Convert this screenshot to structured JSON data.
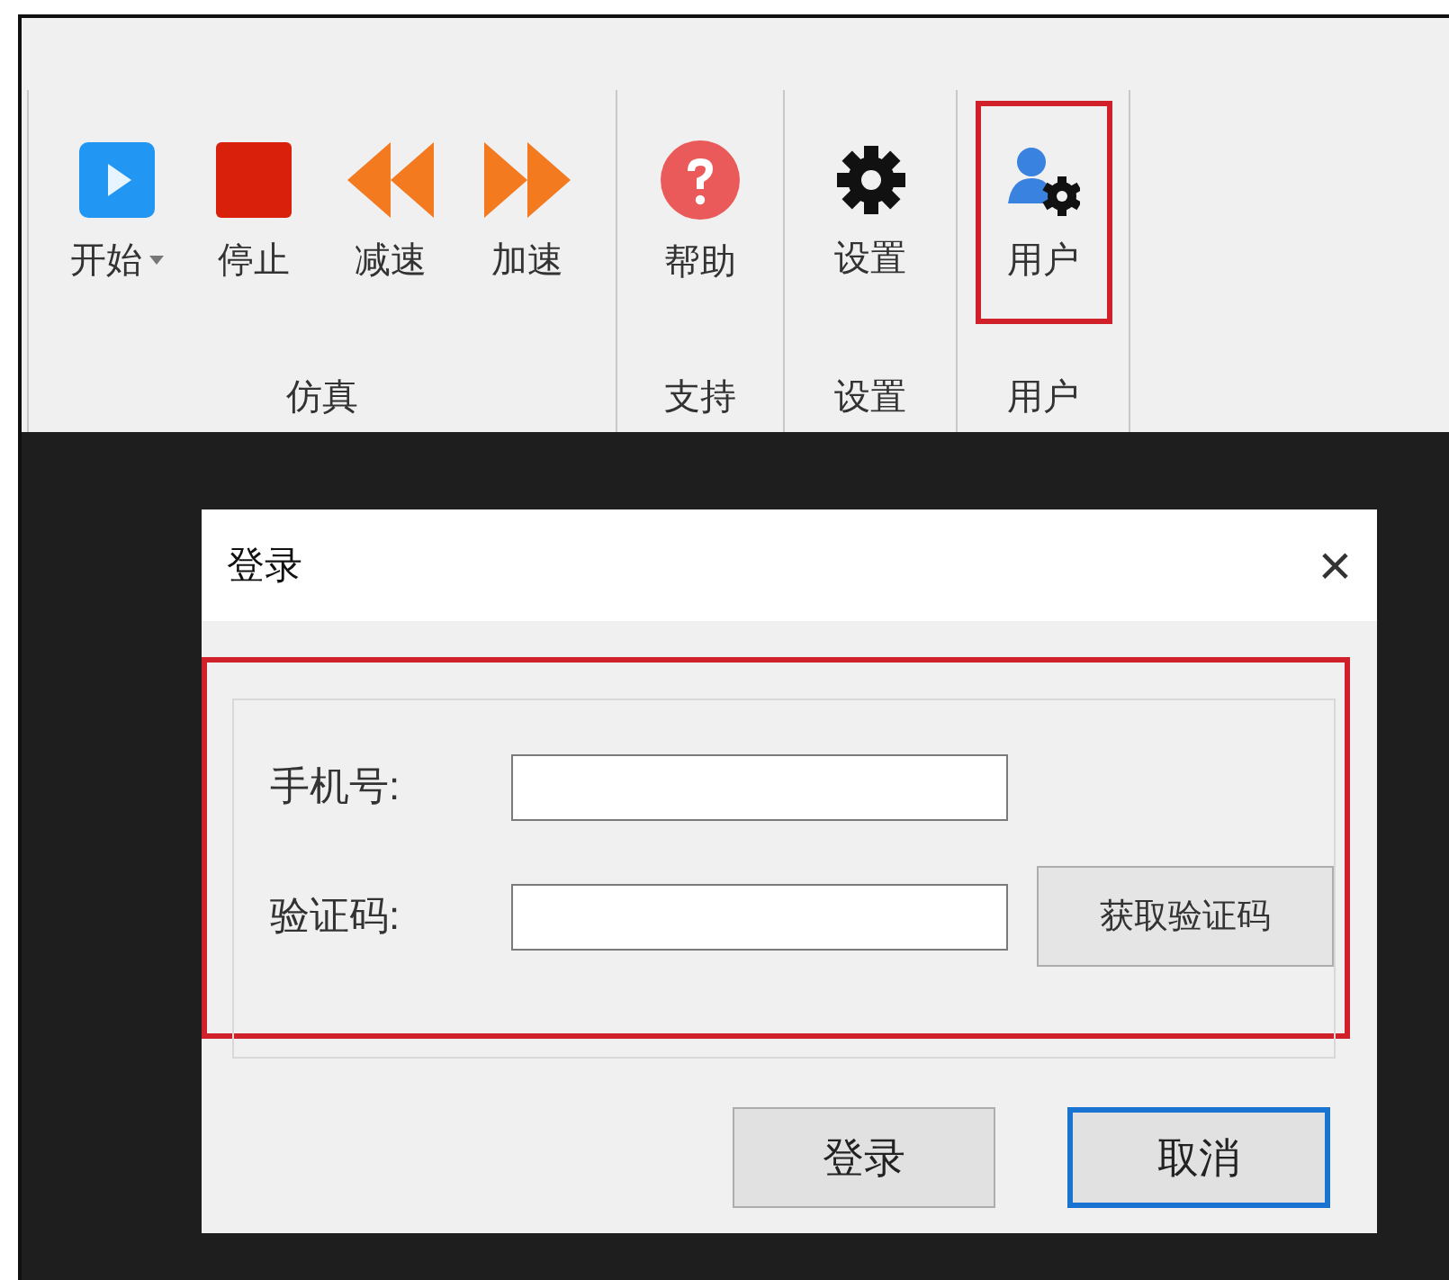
{
  "ribbon": {
    "groups": [
      {
        "label": "仿真",
        "buttons": [
          {
            "label": "开始",
            "kind": "play",
            "dropdown": true,
            "highlighted": false
          },
          {
            "label": "停止",
            "kind": "stop",
            "dropdown": false,
            "highlighted": false
          },
          {
            "label": "减速",
            "kind": "rewind",
            "dropdown": false,
            "highlighted": false
          },
          {
            "label": "加速",
            "kind": "forward",
            "dropdown": false,
            "highlighted": false
          }
        ]
      },
      {
        "label": "支持",
        "buttons": [
          {
            "label": "帮助",
            "kind": "help",
            "dropdown": false,
            "highlighted": false
          }
        ]
      },
      {
        "label": "设置",
        "buttons": [
          {
            "label": "设置",
            "kind": "gear",
            "dropdown": false,
            "highlighted": false
          }
        ]
      },
      {
        "label": "用户",
        "buttons": [
          {
            "label": "用户",
            "kind": "user-gear",
            "dropdown": false,
            "highlighted": true
          }
        ]
      }
    ]
  },
  "dialog": {
    "title": "登录",
    "close": "×",
    "form_highlighted": true,
    "fields": [
      {
        "label": "手机号:"
      },
      {
        "label": "验证码:",
        "action": "获取验证码"
      }
    ],
    "buttons": [
      {
        "label": "登录",
        "default": false
      },
      {
        "label": "取消",
        "default": true
      }
    ]
  }
}
